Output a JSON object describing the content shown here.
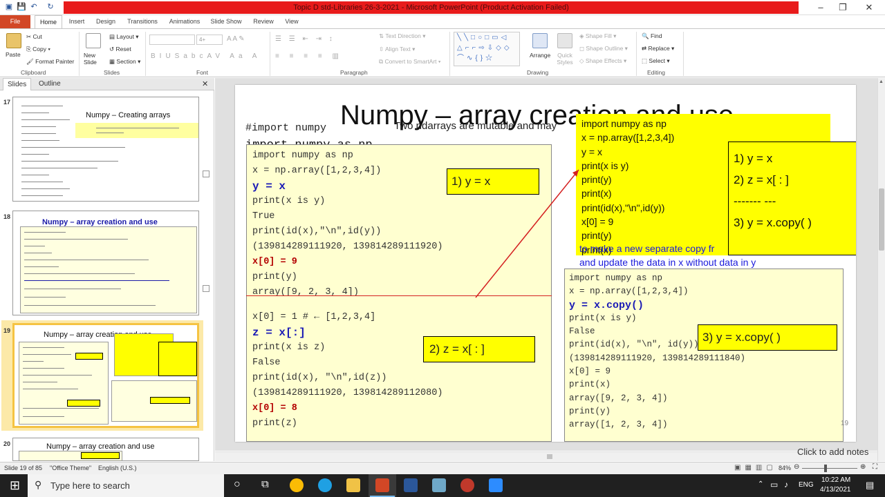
{
  "window": {
    "title": "Topic D std-Libraries 26-3-2021 - Microsoft PowerPoint (Product Activation Failed)",
    "controls": [
      "–",
      "❐",
      "✕"
    ]
  },
  "tabs": [
    "File",
    "Home",
    "Insert",
    "Design",
    "Transitions",
    "Animations",
    "Slide Show",
    "Review",
    "View"
  ],
  "ribbon": {
    "clipboard": {
      "paste": "Paste",
      "cut": "Cut",
      "copy": "Copy",
      "format_painter": "Format Painter",
      "group": "Clipboard"
    },
    "slides": {
      "new_slide": "New Slide",
      "layout": "Layout",
      "reset": "Reset",
      "section": "Section",
      "group": "Slides"
    },
    "font": {
      "group": "Font",
      "size": "4+"
    },
    "paragraph": {
      "text_direction": "Text Direction",
      "align_text": "Align Text",
      "convert_smartart": "Convert to SmartArt",
      "group": "Paragraph"
    },
    "drawing": {
      "arrange": "Arrange",
      "quick_styles": "Quick Styles",
      "shape_fill": "Shape Fill",
      "shape_outline": "Shape Outline",
      "shape_effects": "Shape Effects",
      "group": "Drawing"
    },
    "editing": {
      "find": "Find",
      "replace": "Replace",
      "select": "Select",
      "group": "Editing"
    }
  },
  "pane": {
    "tab_slides": "Slides",
    "tab_outline": "Outline",
    "close": "✕"
  },
  "thumbnails": [
    {
      "num": "17",
      "title": "Numpy – Creating arrays"
    },
    {
      "num": "18",
      "title": "Numpy – array creation and use"
    },
    {
      "num": "19",
      "title": "Numpy – array creation and use"
    },
    {
      "num": "20",
      "title": "Numpy – array creation and use"
    }
  ],
  "slide": {
    "title": "Numpy – array creation and use",
    "subtitle_partial": "Two ndarrays are mutable and may",
    "comment_import": "#import numpy",
    "import_np": "import numpy as np",
    "box_main": [
      "import numpy as np",
      "x = np.array([1,2,3,4])",
      "y = x",
      "print(x is y)",
      "True",
      "print(id(x),\"\\n\",id(y))",
      "(139814289111920, 139814289111920)",
      "x[0] = 9",
      "print(y)",
      "array([9, 2, 3, 4])",
      "x[0] = 1   # ← [1,2,3,4]",
      "z = x[:]",
      "print(x is z)",
      "False",
      "print(id(x),  \"\\n\",id(z))",
      "(139814289111920, 139814289112080)",
      "x[0] = 8",
      "print(z)"
    ],
    "label1": "1) y = x",
    "label2": "2) z = x[ : ]",
    "label3": "3) y = x.copy( )",
    "summary": [
      "1) y = x",
      "2) z = x[ : ]",
      "------- ---",
      "3) y = x.copy( )"
    ],
    "box_right_top": [
      "import numpy as np",
      "x = np.array([1,2,3,4])",
      "y = x",
      "print(x is y)",
      "print(y)",
      "print(x)",
      "print(id(x),\"\\n\",id(y))",
      "x[0] = 9",
      "print(y)",
      "print(x)"
    ],
    "note": [
      "to make a new separate copy fr",
      "and update the data in x without data in y"
    ],
    "box_copy": [
      "import numpy as np",
      "x = np.array([1,2,3,4])",
      "y = x.copy()",
      "print(x is y)",
      "False",
      "print(id(x), \"\\n\", id(y))",
      "(139814289111920, 139814289111840)",
      "x[0] = 9",
      "print(x)",
      "array([9, 2, 3, 4])",
      "print(y)",
      "array([1, 2, 3, 4])"
    ],
    "page_number": "19",
    "notes_placeholder": "Click to add notes"
  },
  "status": {
    "slide": "Slide 19 of 85",
    "theme": "\"Office Theme\"",
    "language": "English (U.S.)",
    "zoom": "84%"
  },
  "taskbar": {
    "search_placeholder": "Type here to search",
    "time": "10:22 AM",
    "date": "4/13/2021",
    "lang": "ENG"
  },
  "colors": {
    "title_bar_red": "#e81b1b",
    "file_tab": "#d24726",
    "highlight_yellow": "#ffff00",
    "code_bg": "#ffffd0",
    "arrow_red": "#d42020",
    "note_blue": "#1a1adb"
  }
}
